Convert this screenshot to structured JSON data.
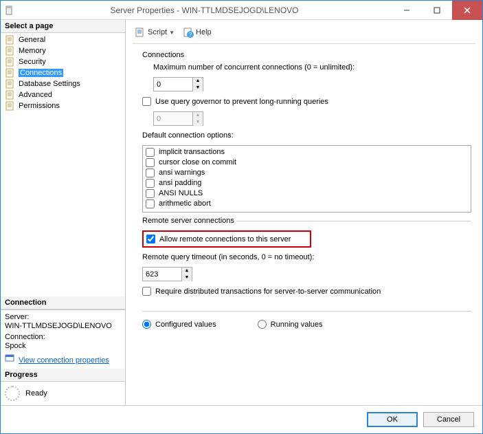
{
  "window": {
    "title": "Server Properties - WIN-TTLMDSEJOGD\\LENOVO"
  },
  "left": {
    "select_page": "Select a page",
    "pages": [
      "General",
      "Memory",
      "Security",
      "Connections",
      "Database Settings",
      "Advanced",
      "Permissions"
    ],
    "selected_index": 3,
    "connection_head": "Connection",
    "server_label": "Server:",
    "server_value": "WIN-TTLMDSEJOGD\\LENOVO",
    "conn_label": "Connection:",
    "conn_value": "Spock",
    "view_props": "View connection properties",
    "progress_head": "Progress",
    "progress_status": "Ready"
  },
  "toolbar": {
    "script": "Script",
    "help": "Help"
  },
  "content": {
    "connections": "Connections",
    "max_conn_label": "Maximum number of concurrent connections (0 = unlimited):",
    "max_conn_value": "0",
    "governor_label": "Use query governor to prevent long-running queries",
    "governor_value": "0",
    "default_opts_label": "Default connection options:",
    "default_opts": [
      "implicit transactions",
      "cursor close on commit",
      "ansi warnings",
      "ansi padding",
      "ANSI NULLS",
      "arithmetic abort"
    ],
    "remote_group": "Remote server connections",
    "allow_remote": "Allow remote connections to this server",
    "remote_timeout_label": "Remote query timeout (in seconds, 0 = no timeout):",
    "remote_timeout_value": "623",
    "require_dist": "Require distributed transactions for server-to-server communication",
    "configured": "Configured values",
    "running": "Running values"
  },
  "footer": {
    "ok": "OK",
    "cancel": "Cancel"
  }
}
